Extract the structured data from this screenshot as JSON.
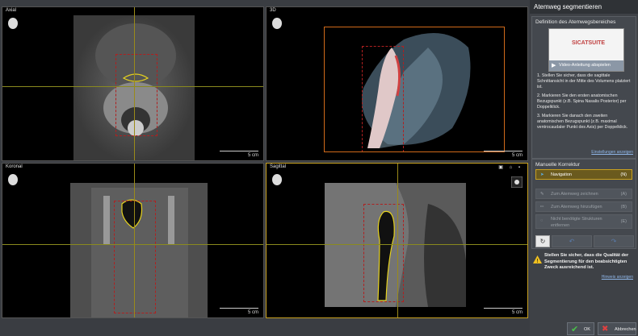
{
  "viewports": {
    "axial": {
      "title": "Axial",
      "scale": "5 cm"
    },
    "threed": {
      "title": "3D",
      "scale": "5 cm"
    },
    "coronal": {
      "title": "Koronal",
      "scale": "5 cm"
    },
    "sagittal": {
      "title": "Sagittal",
      "scale": "5 cm"
    }
  },
  "panel": {
    "title": "Atemweg segmentieren",
    "definition_title": "Definition des Atemwegsbereiches",
    "video_logo": "SICATSUITE",
    "video_button": "Video-Anleitung abspielen",
    "steps": [
      "1. Stellen Sie sicher, dass die sagittale Schnittansicht in der Mitte des Volumens platziert ist.",
      "2. Markieren Sie den ersten anatomischen Bezugspunkt (z.B. Spina Nasalis Posterior) per Doppelklick.",
      "3. Markieren Sie danach den zweiten anatomischen Bezugspunkt (z.B. maximal ventrocaudaler Punkt des Axis) per Doppelklick."
    ],
    "settings_link": "Einstellungen anzeigen",
    "manual_title": "Manuelle Korrektur",
    "tools": [
      {
        "label": "Navigation",
        "key": "(N)"
      },
      {
        "label": "Zum Atemweg zeichnen",
        "key": "(A)"
      },
      {
        "label": "Zum Atemweg hinzufügen",
        "key": "(B)"
      },
      {
        "label": "Nicht benötigte Strukturen entfernen",
        "key": "(E)"
      }
    ],
    "warning": "Stellen Sie sicher, dass die Qualität der Segmentierung für den beabsichtigten Zweck ausreichend ist.",
    "hint_link": "Hinweis anzeigen"
  },
  "footer": {
    "ok": "OK",
    "cancel": "Abbrechen"
  },
  "colors": {
    "accent": "#c8a020",
    "crosshair": "#9a8a1a",
    "roi": "#b02020",
    "airway": "#e6d21e",
    "link": "#8fb6e8"
  }
}
